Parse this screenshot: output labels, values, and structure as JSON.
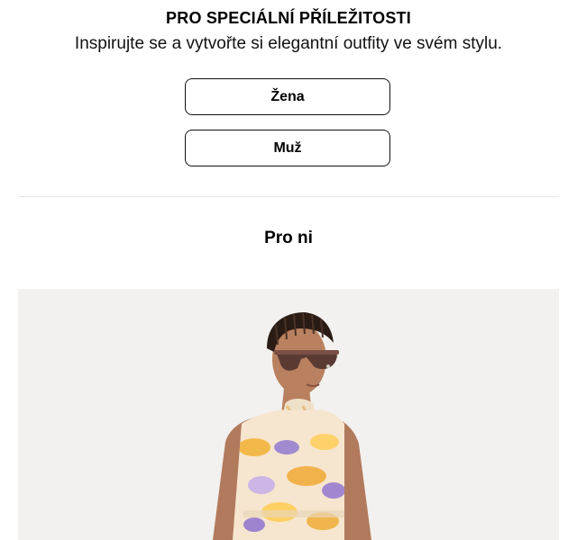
{
  "header": {
    "title": "PRO SPECIÁLNÍ PŘÍLEŽITOSTI",
    "subtitle": "Inspirujte se a vytvořte si elegantní outfity ve svém stylu."
  },
  "buttons": {
    "women_label": "Žena",
    "men_label": "Muž"
  },
  "section": {
    "title": "Pro ni"
  },
  "colors": {
    "image_background": "#f2f1ef",
    "divider": "#e6e6e6",
    "button_border": "#111111"
  }
}
